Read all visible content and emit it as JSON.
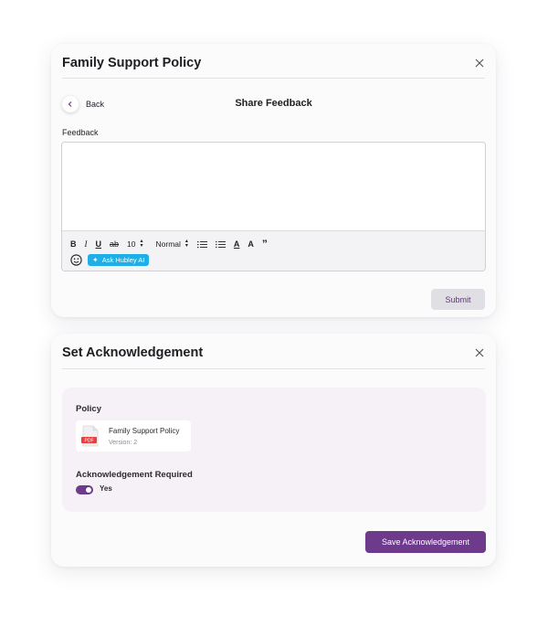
{
  "feedback_dialog": {
    "title": "Family Support Policy",
    "back_label": "Back",
    "heading": "Share Feedback",
    "feedback_label": "Feedback",
    "editor_value": "",
    "toolbar": {
      "bold": "B",
      "italic": "I",
      "underline": "U",
      "strike": "ab",
      "font_size": "10",
      "style": "Normal",
      "font_color": "A",
      "highlight": "A",
      "quote": "”",
      "ask_ai": "Ask Hubley AI"
    },
    "submit_label": "Submit"
  },
  "acknowledgement_dialog": {
    "title": "Set Acknowledgement",
    "policy_label": "Policy",
    "document": {
      "name": "Family Support Policy",
      "version": "Version: 2",
      "icon": "pdf-file-icon",
      "icon_text": "PDF"
    },
    "required_label": "Acknowledgement Required",
    "toggle_on": true,
    "toggle_label": "Yes",
    "save_label": "Save Acknowledgement"
  },
  "colors": {
    "primary": "#6d3a8c",
    "ai_button": "#1eaee8",
    "panel_bg": "#f5f1f7",
    "pdf_red": "#e8403f"
  }
}
